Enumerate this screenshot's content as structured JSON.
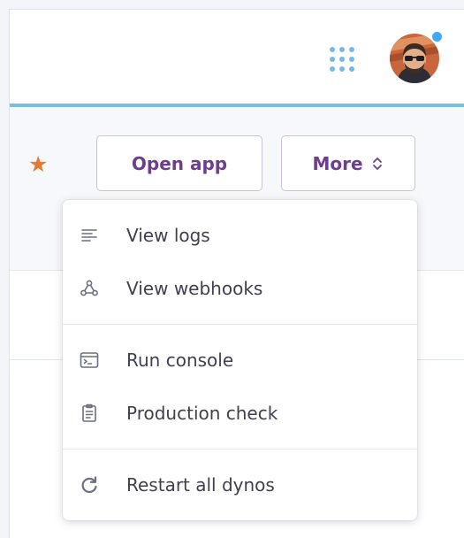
{
  "header": {
    "apps_icon": "grid-dots-icon",
    "avatar_icon": "user-avatar",
    "notification_color": "#40a9f5",
    "accent_color": "#79bfe4"
  },
  "actions": {
    "favorite_icon": "star-icon",
    "favorite_color": "#e8792f",
    "open_app_label": "Open app",
    "more_label": "More",
    "brand_color": "#6d3d8f"
  },
  "menu": {
    "groups": [
      [
        {
          "label": "View logs",
          "icon": "logs-icon"
        },
        {
          "label": "View webhooks",
          "icon": "webhooks-icon"
        }
      ],
      [
        {
          "label": "Run console",
          "icon": "console-icon"
        },
        {
          "label": "Production check",
          "icon": "clipboard-icon"
        }
      ],
      [
        {
          "label": "Restart all dynos",
          "icon": "restart-icon"
        }
      ]
    ]
  }
}
